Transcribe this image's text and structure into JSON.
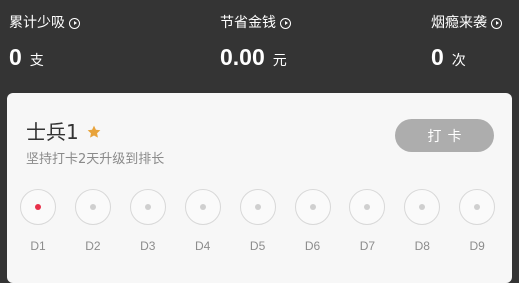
{
  "stats": [
    {
      "label": "累计少吸",
      "value": "0",
      "unit": "支"
    },
    {
      "label": "节省金钱",
      "value": "0.00",
      "unit": "元"
    },
    {
      "label": "烟瘾来袭",
      "value": "0",
      "unit": "次"
    }
  ],
  "card": {
    "rank_title": "士兵1",
    "subtitle": "坚持打卡2天升级到排长",
    "checkin_label": "打卡",
    "days": [
      "D1",
      "D2",
      "D3",
      "D4",
      "D5",
      "D6",
      "D7",
      "D8",
      "D9"
    ],
    "active_day_index": 0
  },
  "colors": {
    "header_bg": "#343434",
    "card_bg": "#f7f7f7",
    "button_bg": "#adadad",
    "star": "#e8a33a",
    "active_dot": "#e8304a"
  }
}
